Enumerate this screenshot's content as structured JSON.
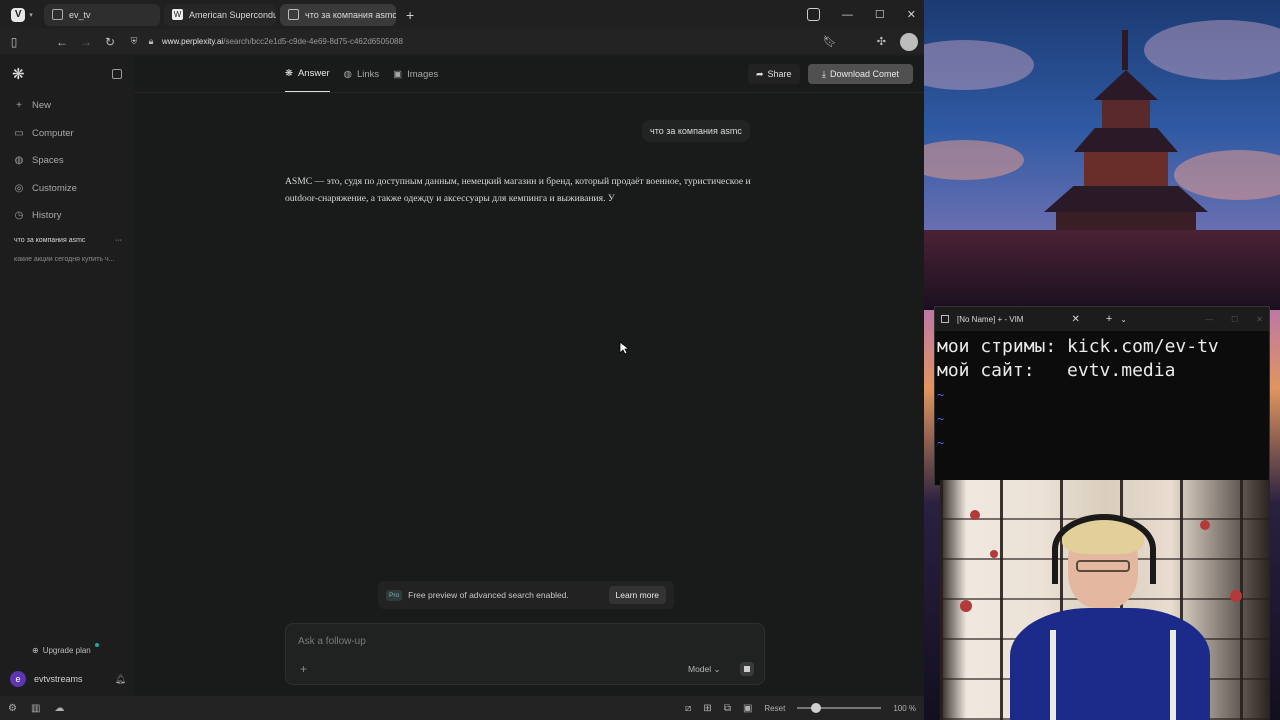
{
  "browser": {
    "tabs": [
      {
        "label": "ev_tv"
      },
      {
        "label": "American Superconductor"
      },
      {
        "label": "что за компания asmc"
      }
    ],
    "url_host": "www.perplexity.ai",
    "url_path": "/search/bcc2e1d5-c9de-4e69-8d75-c462d6505088",
    "status": {
      "reset_label": "Reset",
      "zoom": "100 %"
    }
  },
  "sidebar": {
    "items": [
      {
        "label": "New"
      },
      {
        "label": "Computer"
      },
      {
        "label": "Spaces"
      },
      {
        "label": "Customize"
      },
      {
        "label": "History"
      }
    ],
    "threads": [
      {
        "label": "что за компания asmc"
      },
      {
        "label": "какие акции сегодня купить ч..."
      }
    ],
    "upgrade_label": "Upgrade plan",
    "user": {
      "initial": "e",
      "name": "evtvstreams"
    }
  },
  "main": {
    "tabs": [
      {
        "label": "Answer"
      },
      {
        "label": "Links"
      },
      {
        "label": "Images"
      }
    ],
    "share_label": "Share",
    "download_label": "Download Comet",
    "user_query": "что за компания asmc",
    "answer_text": "ASMC — это, судя по доступным данным, немецкий магазин и бренд, который продаёт военное, туристическое и outdoor-снаряжение, а также одежду и аксессуары для кемпинга и выживания. У",
    "pro_banner": {
      "badge": "Pro",
      "text": "Free preview of advanced search enabled.",
      "learn_more": "Learn more"
    },
    "ask": {
      "placeholder": "Ask a follow-up",
      "model_label": "Model"
    }
  },
  "vim": {
    "title": "[No Name] + - VIM",
    "line1": "мои стримы: kick.com/ev-tv",
    "line2": "мой сайт:   evtv.media"
  }
}
